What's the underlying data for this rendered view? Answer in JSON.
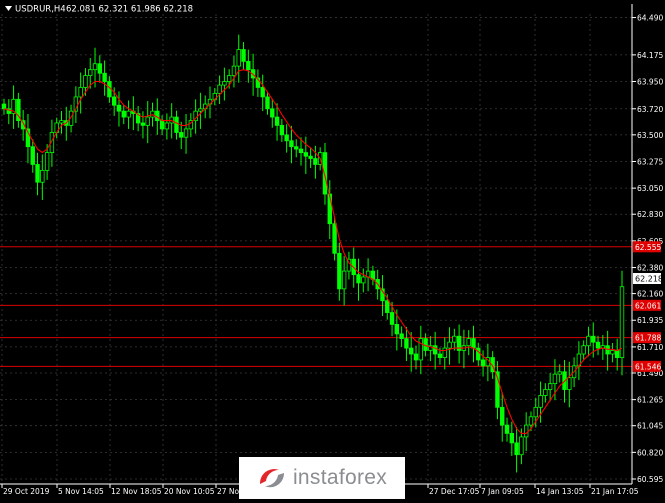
{
  "header": {
    "symbol": "USDRUR,H4",
    "ohlc": "62.081 62.321 61.986 62.218"
  },
  "colors": {
    "background": "#000000",
    "candle": "#00ff00",
    "ma_line": "#ff0000",
    "level_line": "#d90000",
    "level_label_bg": "#e00000",
    "price_label_bg": "#ffffff",
    "grid": "#3a3a3a",
    "text": "#ffffff"
  },
  "watermark": {
    "text": "instaforex",
    "icon": "instaforex-swirl-logo"
  },
  "chart_data": {
    "type": "candlestick",
    "title": "USDRUR,H4",
    "ylim": [
      60.595,
      64.52
    ],
    "grid": true,
    "x_tick_labels": [
      "29 Oct 2019",
      "5 Nov 14:05",
      "12 Nov 18:05",
      "20 Nov 10:05",
      "27 Nov",
      "27 Dec 17:05",
      "7 Jan 09:05",
      "14 Jan 13:05",
      "21 Jan 17:05"
    ],
    "y_ticks": [
      "64.490",
      "64.175",
      "63.950",
      "63.720",
      "63.500",
      "63.275",
      "63.050",
      "62.830",
      "62.605",
      "62.380",
      "62.160",
      "61.935",
      "61.710",
      "61.490",
      "61.265",
      "61.045",
      "60.820",
      "60.595"
    ],
    "current_price": "62.218",
    "levels": [
      "62.555",
      "62.061",
      "61.788",
      "61.546"
    ],
    "close": [
      63.72,
      63.68,
      63.8,
      63.62,
      63.55,
      63.4,
      63.25,
      63.1,
      63.2,
      63.35,
      63.52,
      63.6,
      63.62,
      63.58,
      63.7,
      63.82,
      63.9,
      64.0,
      64.05,
      64.1,
      64.02,
      63.95,
      63.82,
      63.75,
      63.7,
      63.65,
      63.7,
      63.68,
      63.6,
      63.58,
      63.65,
      63.7,
      63.62,
      63.55,
      63.6,
      63.65,
      63.52,
      63.48,
      63.55,
      63.62,
      63.7,
      63.72,
      63.76,
      63.8,
      63.85,
      63.92,
      63.95,
      64.0,
      64.08,
      64.22,
      64.12,
      64.05,
      63.98,
      63.9,
      63.82,
      63.72,
      63.65,
      63.58,
      63.5,
      63.45,
      63.4,
      63.38,
      63.35,
      63.32,
      63.3,
      63.25,
      63.35,
      63.0,
      62.75,
      62.5,
      62.2,
      62.35,
      62.45,
      62.32,
      62.25,
      62.3,
      62.35,
      62.28,
      62.2,
      62.1,
      62.0,
      61.9,
      61.82,
      61.78,
      61.7,
      61.65,
      61.6,
      61.78,
      61.68,
      61.72,
      61.65,
      61.62,
      61.7,
      61.75,
      61.8,
      61.68,
      61.72,
      61.78,
      61.7,
      61.6,
      61.55,
      61.62,
      61.5,
      61.2,
      61.05,
      60.98,
      60.9,
      60.8,
      60.95,
      61.05,
      61.12,
      61.2,
      61.3,
      61.35,
      61.4,
      61.48,
      61.5,
      61.35,
      61.45,
      61.55,
      61.65,
      61.72,
      61.8,
      61.75,
      61.7,
      61.72,
      61.65,
      61.68,
      61.62,
      62.218
    ],
    "ma": [
      63.72,
      63.71,
      63.7,
      63.66,
      63.6,
      63.52,
      63.45,
      63.38,
      63.35,
      63.38,
      63.45,
      63.52,
      63.58,
      63.6,
      63.65,
      63.72,
      63.8,
      63.86,
      63.92,
      63.95,
      63.95,
      63.93,
      63.9,
      63.86,
      63.8,
      63.75,
      63.72,
      63.7,
      63.67,
      63.65,
      63.66,
      63.67,
      63.65,
      63.62,
      63.62,
      63.62,
      63.6,
      63.58,
      63.58,
      63.6,
      63.64,
      63.68,
      63.72,
      63.76,
      63.8,
      63.84,
      63.88,
      63.92,
      63.98,
      64.04,
      64.05,
      64.04,
      64.01,
      63.97,
      63.92,
      63.86,
      63.8,
      63.74,
      63.67,
      63.61,
      63.55,
      63.5,
      63.46,
      63.42,
      63.39,
      63.35,
      63.3,
      63.15,
      62.98,
      62.8,
      62.62,
      62.5,
      62.42,
      62.38,
      62.34,
      62.32,
      62.3,
      62.28,
      62.24,
      62.18,
      62.12,
      62.05,
      61.98,
      61.92,
      61.86,
      61.8,
      61.76,
      61.74,
      61.72,
      61.71,
      61.7,
      61.68,
      61.68,
      61.69,
      61.7,
      61.7,
      61.7,
      61.71,
      61.7,
      61.67,
      61.63,
      61.6,
      61.55,
      61.45,
      61.32,
      61.2,
      61.1,
      61.02,
      60.98,
      60.98,
      61.02,
      61.08,
      61.14,
      61.2,
      61.26,
      61.32,
      61.38,
      61.42,
      61.46,
      61.5,
      61.55,
      61.6,
      61.64,
      61.67,
      61.69,
      61.7,
      61.69,
      61.69,
      61.68,
      61.7
    ]
  }
}
